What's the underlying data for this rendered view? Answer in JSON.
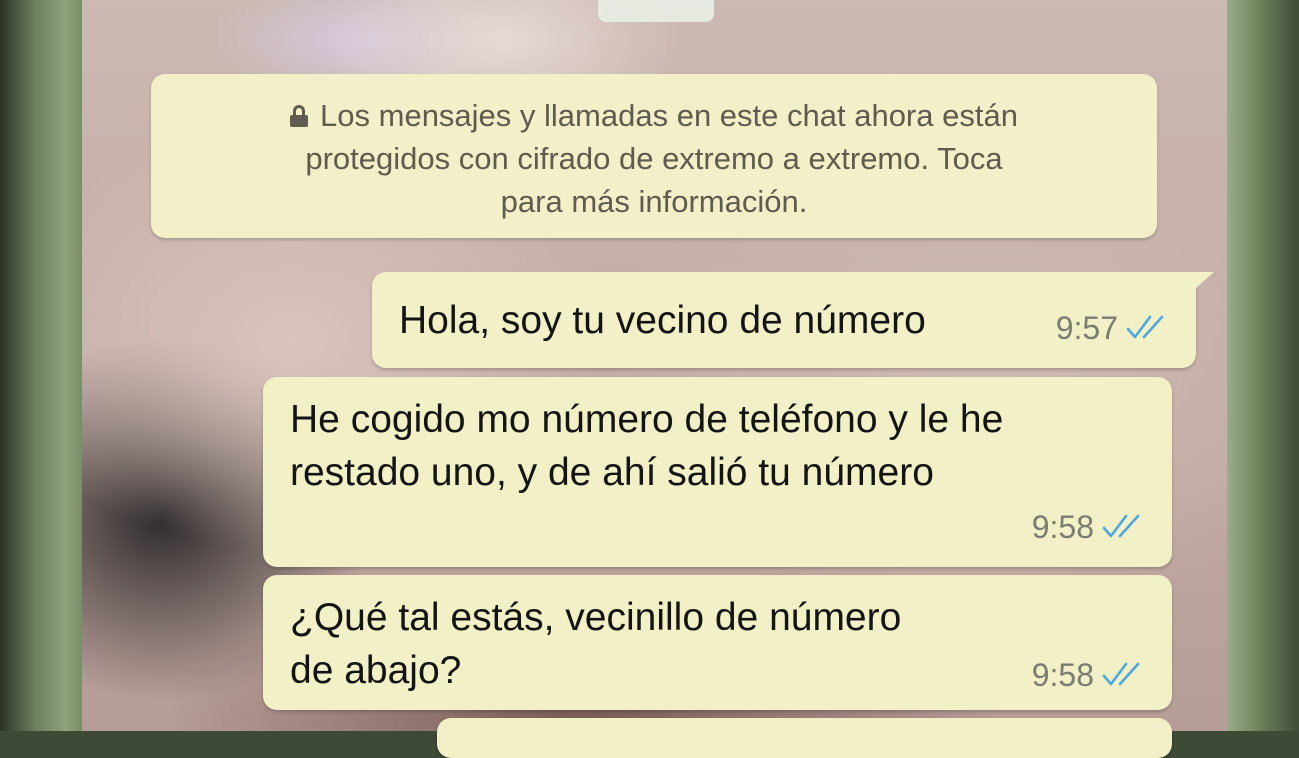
{
  "system_message": {
    "lines": [
      "Los mensajes y llamadas en este chat ahora están",
      "protegidos con cifrado de extremo a extremo. Toca",
      "para más información."
    ],
    "icon": "lock-icon"
  },
  "messages": [
    {
      "lines": [
        "Hola, soy tu vecino de número"
      ],
      "time": "9:57",
      "status_icon": "double-check-icon",
      "tick_color": "#4fa6e0"
    },
    {
      "lines": [
        "He cogido mo número de teléfono y le he",
        "restado uno, y de ahí salió tu número"
      ],
      "time": "9:58",
      "status_icon": "double-check-icon",
      "tick_color": "#4fa6e0"
    },
    {
      "lines": [
        "¿Qué tal estás, vecinillo de número",
        "de abajo?"
      ],
      "time": "9:58",
      "status_icon": "double-check-icon",
      "tick_color": "#4fa6e0"
    }
  ],
  "colors": {
    "bubble": "#f1f0c7",
    "system_bubble": "#f3efc8",
    "read_ticks": "#4fa6e0"
  }
}
